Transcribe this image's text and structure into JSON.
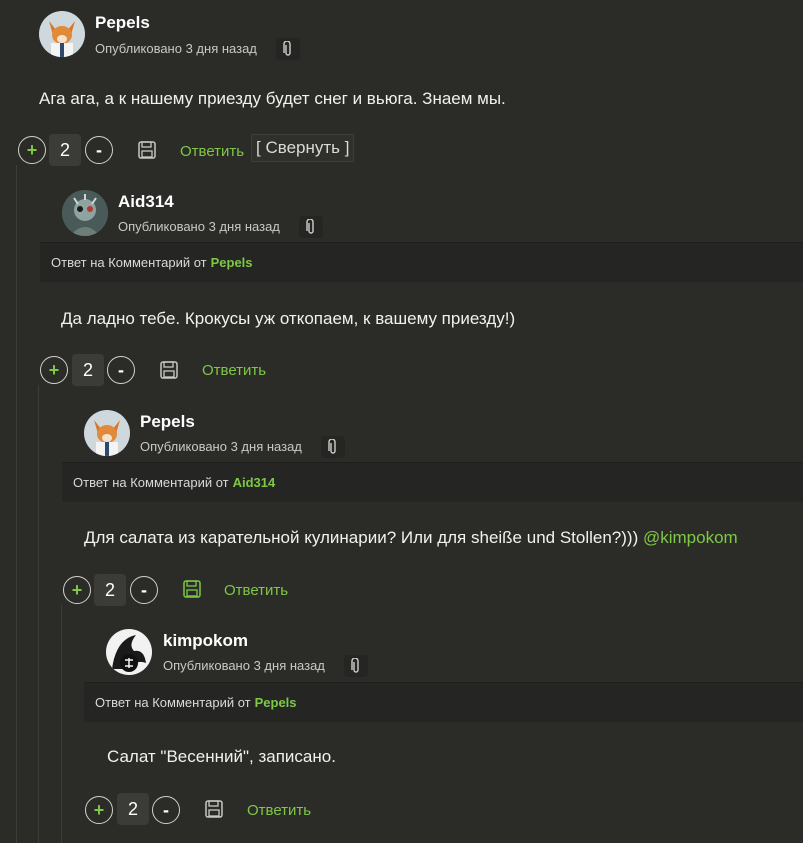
{
  "comments": [
    {
      "author": "Pepels",
      "published": "Опубликовано 3 дня назад",
      "reply_prefix": "",
      "reply_to": "",
      "text": "Ага ага, а к нашему приезду будет снег и вьюга. Знаем мы.",
      "votes": "2",
      "reply_label": "Ответить",
      "collapse_label": "[ Свернуть ]",
      "avatar": "fox-avatar"
    },
    {
      "author": "Aid314",
      "published": "Опубликовано 3 дня назад",
      "reply_prefix": "Ответ на Комментарий от",
      "reply_to": "Pepels",
      "text": "Да ладно тебе. Крокусы уж откопаем, к вашему приезду!)",
      "votes": "2",
      "reply_label": "Ответить",
      "avatar": "cyborg-avatar"
    },
    {
      "author": "Pepels",
      "published": "Опубликовано 3 дня назад",
      "reply_prefix": "Ответ на Комментарий от",
      "reply_to": "Aid314",
      "text": "Для салата из карательной кулинарии? Или для sheiße und Stollen?)))",
      "mention": "@kimpokom",
      "votes": "2",
      "reply_label": "Ответить",
      "avatar": "fox-avatar"
    },
    {
      "author": "kimpokom",
      "published": "Опубликовано 3 дня назад",
      "reply_prefix": "Ответ на Комментарий от",
      "reply_to": "Pepels",
      "text": "Салат \"Весенний\", записано.",
      "votes": "2",
      "reply_label": "Ответить",
      "avatar": "wolf-avatar"
    }
  ],
  "vote_up_symbol": "+",
  "vote_down_symbol": "-",
  "colors": {
    "accent": "#7fc846",
    "background": "#2b2c28",
    "reply_bar": "#252623"
  }
}
